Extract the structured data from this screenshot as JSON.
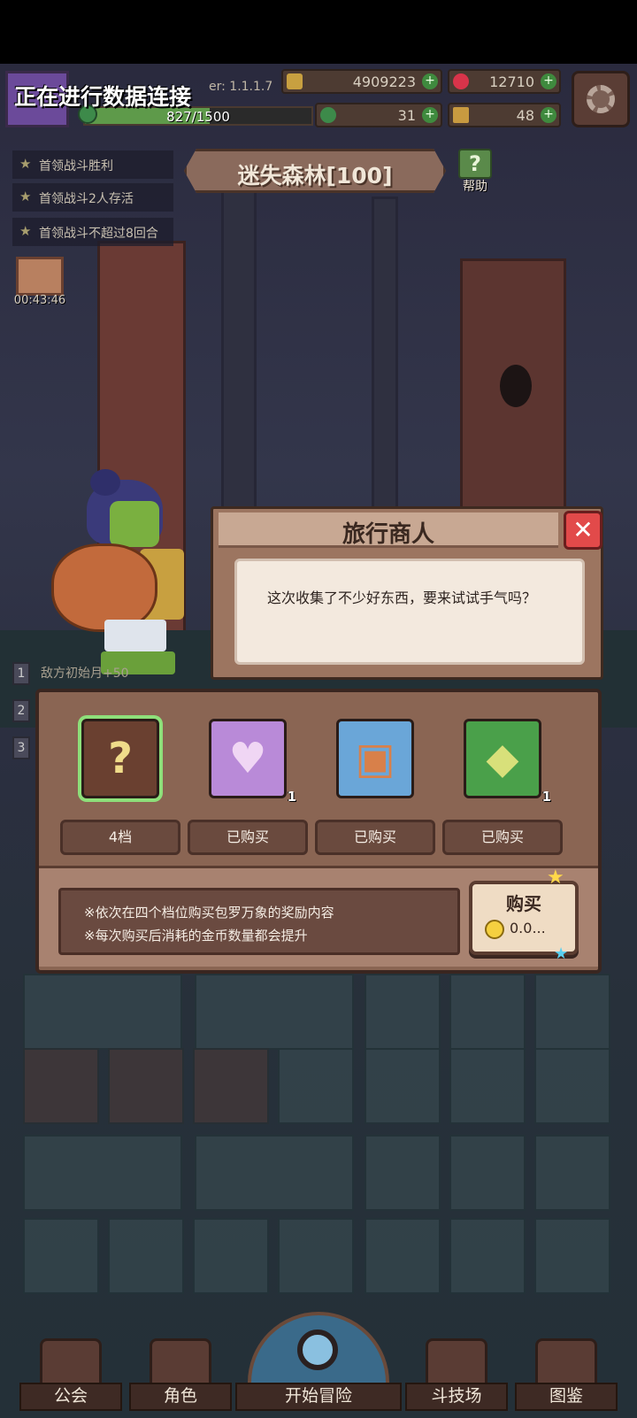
{
  "header": {
    "connecting_text": "正在进行数据连接",
    "version": "er: 1.1.1.7",
    "exp": "827/1500",
    "exp_fraction": 0.55,
    "gold": "4909223",
    "gems": "12710",
    "clover": "31",
    "keys": "48"
  },
  "quests": [
    "首领战斗胜利",
    "首领战斗2人存活",
    "首领战斗不超过8回合"
  ],
  "stage": {
    "title": "迷失森林[100]",
    "help_label": "帮助"
  },
  "gift": {
    "timer": "00:43:46"
  },
  "list_rows": {
    "numbers": [
      "1",
      "2",
      "3"
    ],
    "first_text": "敌方初始月+50"
  },
  "dialog": {
    "title": "旅行商人",
    "message": "这次收集了不少好东西，要来试试手气吗？"
  },
  "shop": {
    "slots": [
      {
        "icon": "question-icon",
        "glyph": "?",
        "count": "",
        "status": "4档",
        "color": "#6a4030"
      },
      {
        "icon": "heart-gem-icon",
        "glyph": "♥",
        "count": "1",
        "status": "已购买",
        "color": "#b98ad8"
      },
      {
        "icon": "scroll-icon",
        "glyph": "▣",
        "count": "",
        "status": "已购买",
        "color": "#6aa6d8"
      },
      {
        "icon": "green-crystal-icon",
        "glyph": "◆",
        "count": "1",
        "status": "已购买",
        "color": "#4aa04a"
      }
    ],
    "info_line1": "※依次在四个档位购买包罗万象的奖励内容",
    "info_line2": "※每次购买后消耗的金币数量都会提升",
    "buy_label": "购买",
    "buy_price": "0.0..."
  },
  "nav": {
    "guild": "公会",
    "character": "角色",
    "start_adventure": "开始冒险",
    "arena": "斗技场",
    "codex": "图鉴"
  }
}
